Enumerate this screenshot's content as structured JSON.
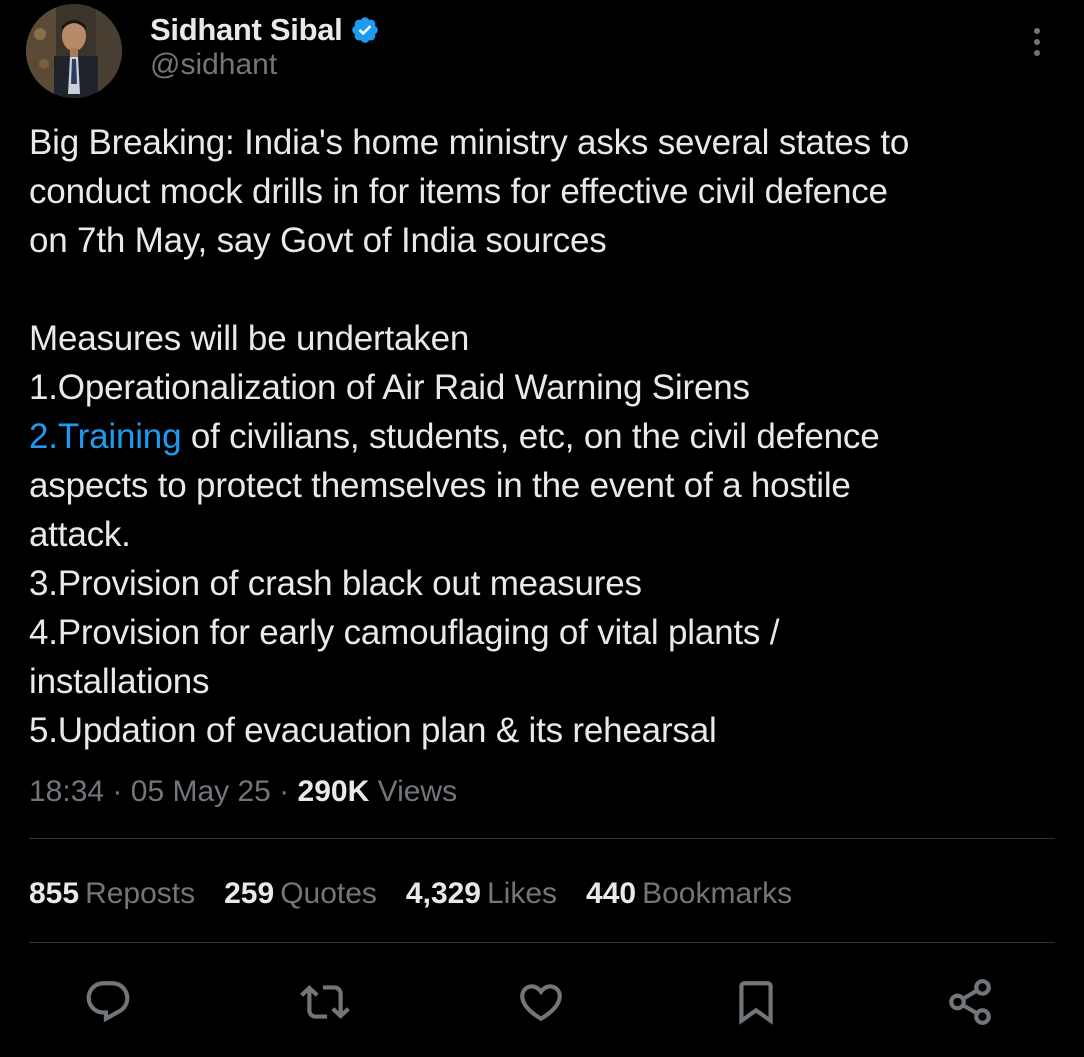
{
  "author": {
    "display_name": "Sidhant Sibal",
    "handle": "@sidhant",
    "verified": true,
    "avatar_icon": "profile-photo"
  },
  "tweet": {
    "lines": [
      "Big Breaking: India's home ministry asks several states to",
      "conduct mock drills in for items for effective civil defence",
      "on 7th May, say Govt of India sources",
      "",
      "Measures will be undertaken",
      "1.Operationalization of Air Raid Warning Sirens"
    ],
    "link_text": "2.Training",
    "link_line_rest": " of civilians, students, etc, on the civil defence",
    "lines_after": [
      "aspects to protect themselves in the event of a hostile",
      "attack.",
      "3.Provision of crash black out measures",
      "4.Provision for early camouflaging of vital plants /",
      "installations",
      "5.Updation of evacuation plan & its rehearsal"
    ]
  },
  "meta": {
    "time": "18:34",
    "separator": "·",
    "date": "05 May 25",
    "views_count": "290K",
    "views_label": "Views"
  },
  "stats": {
    "reposts_count": "855",
    "reposts_label": "Reposts",
    "quotes_count": "259",
    "quotes_label": "Quotes",
    "likes_count": "4,329",
    "likes_label": "Likes",
    "bookmarks_count": "440",
    "bookmarks_label": "Bookmarks"
  },
  "actions": [
    "reply-icon",
    "repost-icon",
    "like-icon",
    "bookmark-icon",
    "share-icon"
  ],
  "colors": {
    "background": "#000000",
    "text_primary": "#E7E9EA",
    "text_secondary": "#71767B",
    "link": "#1D9BF0",
    "verified": "#1D9BF0",
    "divider": "#2F3336"
  }
}
